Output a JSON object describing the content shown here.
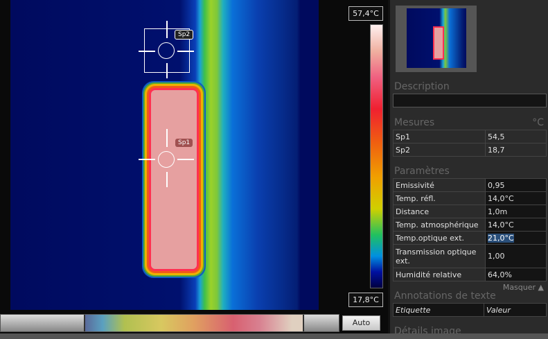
{
  "scale": {
    "max": "57,4°C",
    "min": "17,8°C"
  },
  "spots": [
    {
      "label": "Sp1"
    },
    {
      "label": "Sp2"
    }
  ],
  "toolbar": {
    "auto_label": "Auto"
  },
  "panel": {
    "description_title": "Description",
    "description_value": "",
    "measures_title": "Mesures",
    "measures_unit": "°C",
    "measures": [
      {
        "name": "Sp1",
        "value": "54,5"
      },
      {
        "name": "Sp2",
        "value": "18,7"
      }
    ],
    "params_title": "Paramètres",
    "params": [
      {
        "name": "Emissivité",
        "value": "0,95"
      },
      {
        "name": "Temp. réfl.",
        "value": "14,0°C"
      },
      {
        "name": "Distance",
        "value": "1,0m"
      },
      {
        "name": "Temp. atmosphérique",
        "value": "14,0°C"
      },
      {
        "name": "Temp.optique ext.",
        "value": "21,0°C"
      },
      {
        "name": "Transmission optique ext.",
        "value": "1,00"
      },
      {
        "name": "Humidité relative",
        "value": "64,0%"
      }
    ],
    "hide_label": "Masquer ▲",
    "annotations_title": "Annotations de texte",
    "annotations_cols": [
      "Etiquette",
      "Valeur"
    ],
    "details_title": "Détails image"
  }
}
